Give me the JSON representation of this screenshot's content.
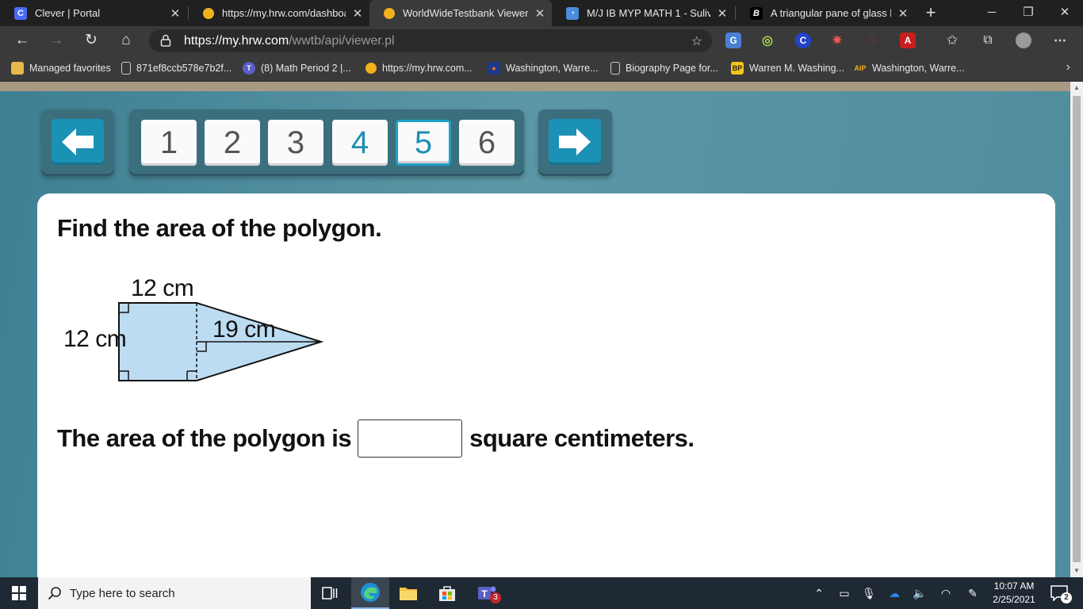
{
  "browser": {
    "tabs": [
      {
        "title": "Clever | Portal",
        "favicon": "clever-icon",
        "favicon_text": "C",
        "favicon_color": "#4b6bff",
        "active": false
      },
      {
        "title": "https://my.hrw.com/dashboard",
        "favicon": "hrw-icon",
        "favicon_color": "#f2b01e",
        "active": false
      },
      {
        "title": "WorldWideTestbank Viewer",
        "favicon": "hrw-icon",
        "favicon_color": "#f2b01e",
        "active": true
      },
      {
        "title": "M/J IB MYP MATH 1 - Sulivera",
        "favicon": "classroom-icon",
        "favicon_color": "#4a8bdc",
        "active": false
      },
      {
        "title": "A triangular pane of glass has a",
        "favicon": "brainly-icon",
        "favicon_text": "B",
        "favicon_color": "#000000",
        "active": false
      }
    ],
    "address": {
      "url_host": "https://my.hrw.com",
      "url_path": "/wwtb/api/viewer.pl"
    },
    "favorites": [
      {
        "label": "Managed favorites",
        "icon": "folder-icon"
      },
      {
        "label": "871ef8ccb578e7b2f...",
        "icon": "page-icon"
      },
      {
        "label": "(8) Math Period 2 |...",
        "icon": "teams-icon"
      },
      {
        "label": "https://my.hrw.com...",
        "icon": "hrw-icon"
      },
      {
        "label": "Washington, Warre...",
        "icon": "school-icon"
      },
      {
        "label": "Biography Page for...",
        "icon": "page-icon"
      },
      {
        "label": "Warren M. Washing...",
        "icon": "bp-icon"
      },
      {
        "label": "Washington, Warre...",
        "icon": "aip-icon"
      }
    ]
  },
  "viewer": {
    "question_numbers": [
      "1",
      "2",
      "3",
      "4",
      "5",
      "6"
    ],
    "answered_index": 3,
    "current_index": 4,
    "prompt": "Find the area of the polygon.",
    "figure": {
      "top_label": "12 cm",
      "side_label": "12 cm",
      "height_label": "19 cm"
    },
    "answer_prefix": "The area of the polygon is",
    "answer_value": "",
    "answer_suffix": "square centimeters."
  },
  "taskbar": {
    "search_placeholder": "Type here to search",
    "time": "10:07 AM",
    "date": "2/25/2021",
    "teams_badge": "3",
    "notification_count": "2"
  },
  "colors": {
    "page_teal": "#4e8a9b",
    "nav_blue": "#1a91b5",
    "shape_fill": "#bcdcf2"
  }
}
